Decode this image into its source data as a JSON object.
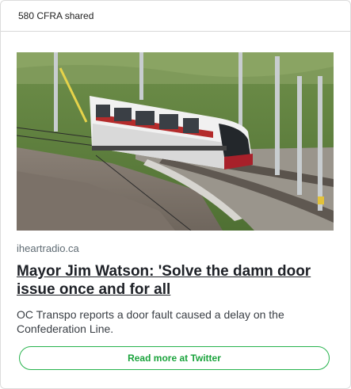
{
  "header": {
    "share_text": "580 CFRA shared"
  },
  "article": {
    "source": "iheartradio.ca",
    "headline": "Mayor Jim Watson: 'Solve the damn door issue once and for all",
    "description": "OC Transpo reports a door fault caused a delay on the Confederation Line.",
    "image_subject": "light-rail-train-photo"
  },
  "actions": {
    "read_more_label": "Read more at Twitter"
  },
  "colors": {
    "accent": "#1aa33c",
    "headline": "#1e2127",
    "source": "#5f6b73"
  }
}
